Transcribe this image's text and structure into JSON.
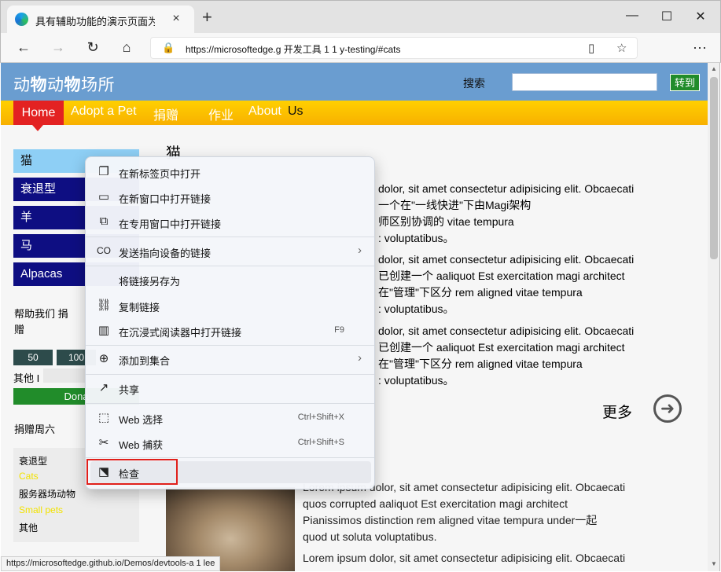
{
  "browser": {
    "tab_title": "具有辅助功能的演示页面为",
    "tab_close": "×",
    "new_tab": "+",
    "window_controls": {
      "minimize": "—",
      "maximize": "☐",
      "close": "✕"
    },
    "back_icon": "back-arrow-icon",
    "url": "https://microsoftedge.g 开发工具 1 1 y-testing/#cats",
    "status_url": "https://microsoftedge.github.io/Demos/devtools-a 1 lee"
  },
  "site": {
    "title_parts": [
      "动",
      "物",
      "动",
      "物",
      "场所"
    ],
    "search_label": "搜索",
    "search_value": "",
    "go_label": "转到"
  },
  "nav": {
    "home": "Home",
    "items": [
      "Adopt a Pet",
      "捐赠",
      "作业",
      "About",
      "Us"
    ]
  },
  "sidebar": {
    "items": [
      "猫",
      "衰退型",
      "羊",
      "马",
      "Alpacas"
    ]
  },
  "donate": {
    "title": "帮助我们 捐赠",
    "amounts": [
      "50",
      "100"
    ],
    "other_label": "其他 I",
    "donate_label": "Dona"
  },
  "weekly": {
    "title": "捐赠周六",
    "items": [
      {
        "text": "衰退型",
        "color": "#111111"
      },
      {
        "text": "Cats",
        "color": "#f2e200"
      },
      {
        "text": "服务器场动物",
        "color": "#111111"
      },
      {
        "text": "Small pets",
        "color": "#f2e200"
      },
      {
        "text": "其他",
        "color": "#111111"
      }
    ]
  },
  "main": {
    "heading": "猫",
    "para1": [
      "dolor, sit amet consectetur adipisicing elit. Obcaecati",
      "一个在\"一线快进\"下由Magi架构",
      "师区别协调的 vitae tempura",
      ": voluptatibus。"
    ],
    "para2": [
      "dolor, sit amet consectetur adipisicing elit. Obcaecati",
      "已创建一个 aaliquot Est exercitation magi architect",
      "在\"管理\"下区分 rem aligned vitae tempura",
      ": voluptatibus。"
    ],
    "para3": [
      "dolor, sit amet consectetur adipisicing elit. Obcaecati",
      "已创建一个 aaliquot Est exercitation magi architect",
      "在\"管理\"下区分 rem aligned vitae tempura",
      ": voluptatibus。"
    ],
    "more_label": "更多",
    "para4": [
      "Lorem ipsum dolor, sit amet consectetur adipisicing elit. Obcaecati",
      "quos corrupted aaliquot Est exercitation magi architect",
      "Pianissimos distinction rem aligned vitae tempura under一起",
      "quod ut soluta voluptatibus."
    ],
    "para5": [
      "Lorem ipsum dolor, sit amet consectetur adipisicing elit. Obcaecati"
    ]
  },
  "context_menu": {
    "items": [
      {
        "label": "在新标签页中打开",
        "icon": "new-tab-icon",
        "glyph": "❐"
      },
      {
        "label": "在新窗口中打开链接",
        "icon": "new-window-icon",
        "glyph": "▭"
      },
      {
        "label": "在专用窗口中打开链接",
        "icon": "inprivate-window-icon",
        "glyph": "⧉"
      },
      {
        "label": "发送指向设备的链接",
        "icon": "send-to-device-icon",
        "glyph": "CO",
        "arrow": "›"
      },
      {
        "label": "将链接另存为",
        "icon": "",
        "glyph": ""
      },
      {
        "label": "复制链接",
        "icon": "copy-link-icon",
        "glyph": "⛓"
      },
      {
        "label": "在沉浸式阅读器中打开链接",
        "icon": "immersive-reader-icon",
        "glyph": "📖",
        "shortcut": "F9"
      },
      {
        "label": "添加到集合",
        "icon": "collections-icon",
        "glyph": "⊕",
        "arrow": "›"
      },
      {
        "label": "共享",
        "icon": "share-icon",
        "glyph": "↗"
      },
      {
        "label": "Web 选择",
        "icon": "web-select-icon",
        "glyph": "⬚",
        "shortcut": "Ctrl+Shift+X"
      },
      {
        "label": "Web 捕获",
        "icon": "web-capture-icon",
        "glyph": "✂",
        "shortcut": "Ctrl+Shift+S"
      },
      {
        "label": "检查",
        "icon": "inspect-icon",
        "glyph": "⬔"
      }
    ]
  }
}
